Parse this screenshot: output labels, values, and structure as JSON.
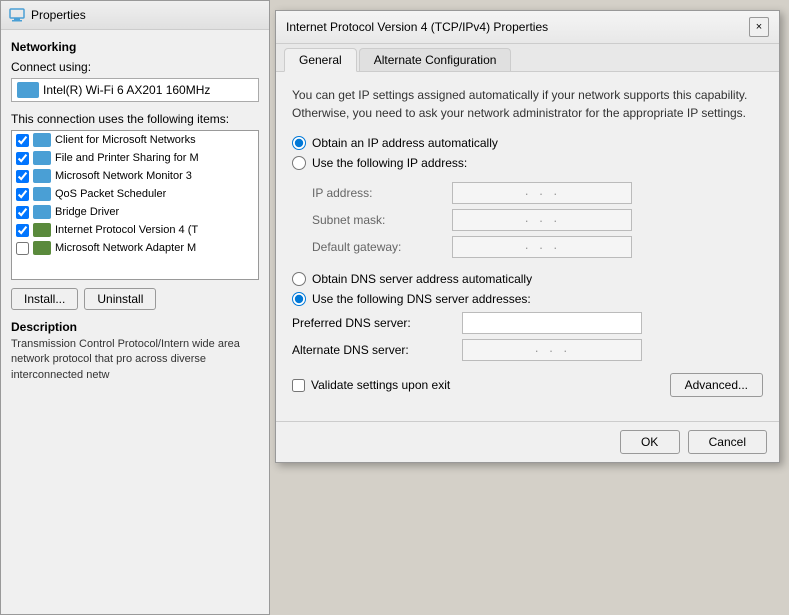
{
  "bg_window": {
    "title": "Properties",
    "title_icon": "network-icon",
    "networking_label": "Networking",
    "connect_using_label": "Connect using:",
    "adapter_name": "Intel(R) Wi-Fi 6 AX201 160MHz",
    "items_label": "This connection uses the following items:",
    "list_items": [
      {
        "checked": true,
        "icon": "network-icon",
        "label": "Client for Microsoft Networks"
      },
      {
        "checked": true,
        "icon": "network-icon",
        "label": "File and Printer Sharing for M"
      },
      {
        "checked": true,
        "icon": "monitor-icon",
        "label": "Microsoft Network Monitor 3"
      },
      {
        "checked": true,
        "icon": "network-icon",
        "label": "QoS Packet Scheduler"
      },
      {
        "checked": true,
        "icon": "network-icon",
        "label": "Bridge Driver"
      },
      {
        "checked": true,
        "icon": "protocol-icon",
        "label": "Internet Protocol Version 4 (T"
      },
      {
        "checked": false,
        "icon": "protocol-icon",
        "label": "Microsoft Network Adapter M"
      }
    ],
    "install_btn": "Install...",
    "uninstall_btn": "Uninstall",
    "description_label": "Description",
    "description_text": "Transmission Control Protocol/Intern wide area network protocol that pro across diverse interconnected netw"
  },
  "dialog": {
    "title": "Internet Protocol Version 4 (TCP/IPv4) Properties",
    "close_btn_label": "×",
    "tabs": [
      {
        "label": "General",
        "active": true
      },
      {
        "label": "Alternate Configuration",
        "active": false
      }
    ],
    "info_text": "You can get IP settings assigned automatically if your network supports this capability. Otherwise, you need to ask your network administrator for the appropriate IP settings.",
    "obtain_ip_radio": "Obtain an IP address automatically",
    "use_ip_radio": "Use the following IP address:",
    "ip_address_label": "IP address:",
    "ip_address_placeholder": "·  ·  ·",
    "subnet_mask_label": "Subnet mask:",
    "subnet_mask_placeholder": "·  ·  ·",
    "default_gateway_label": "Default gateway:",
    "default_gateway_placeholder": "·  ·  ·",
    "obtain_dns_radio": "Obtain DNS server address automatically",
    "use_dns_radio": "Use the following DNS server addresses:",
    "preferred_dns_label": "Preferred DNS server:",
    "preferred_dns_value": "",
    "alternate_dns_label": "Alternate DNS server:",
    "alternate_dns_placeholder": "·  ·  ·",
    "validate_checkbox_label": "Validate settings upon exit",
    "advanced_btn": "Advanced...",
    "ok_btn": "OK",
    "cancel_btn": "Cancel"
  }
}
